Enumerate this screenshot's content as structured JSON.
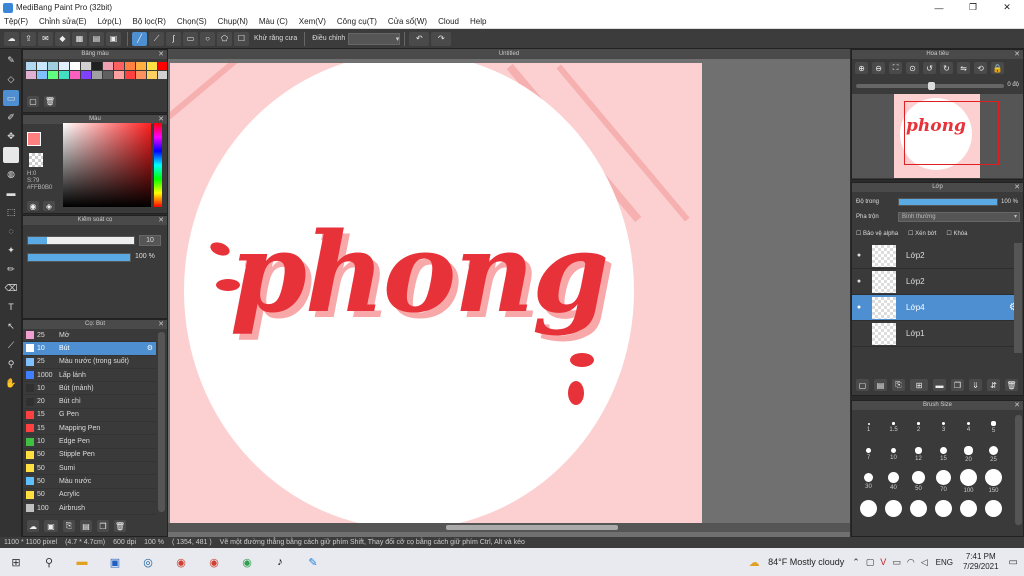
{
  "window": {
    "title": "MediBang Paint Pro (32bit)",
    "controls": [
      "—",
      "❐",
      "✕"
    ]
  },
  "menu": [
    "Tệp(F)",
    "Chỉnh sửa(E)",
    "Lớp(L)",
    "Bộ lọc(R)",
    "Chọn(S)",
    "Chụp(N)",
    "Màu (C)",
    "Xem(V)",
    "Công cụ(T)",
    "Cửa sổ(W)",
    "Cloud",
    "Help"
  ],
  "toolbar": {
    "antialias_label": "Khử răng cưa",
    "adjust_label": "Điều chỉnh",
    "undo_icon": "undo-icon",
    "redo_icon": "redo-icon"
  },
  "panels": {
    "color_palette": {
      "title": "Bảng màu",
      "swatches": [
        "#b0d8f0",
        "#c8e8ff",
        "#a0d0e0",
        "#e0f0ff",
        "#ffffff",
        "#d0d0d0",
        "#202020",
        "#f0a0b0",
        "#ff6060",
        "#ff8040",
        "#ffb040",
        "#ffe040",
        "#ff0000",
        "#e0b0d0",
        "#80c0ff",
        "#60ff80",
        "#40e0c0",
        "#ff60c0",
        "#8040ff",
        "#a0a0a0",
        "#606060",
        "#ffa0a0",
        "#ff4040",
        "#ff9060",
        "#ffd060",
        "#d0d0d0"
      ]
    },
    "color": {
      "title": "Màu",
      "main": "#ff8080",
      "sub": "#ffffff",
      "h": "H:0",
      "s": "S:79",
      "hex": "#FFB0B0"
    },
    "brush_control": {
      "title": "Kiểm soát cọ",
      "size": "10",
      "opacity": "100 %",
      "opacity_value": 1.0
    },
    "brushes": {
      "title": "Cọ: Bút",
      "items": [
        {
          "num": "25",
          "name": "Mờ",
          "color": "#f0a0d0"
        },
        {
          "num": "10",
          "name": "Bút",
          "color": "#ffffff",
          "selected": true
        },
        {
          "num": "25",
          "name": "Màu nước (trong suốt)",
          "color": "#80c0ff"
        },
        {
          "num": "1000",
          "name": "Lấp lánh",
          "color": "#4080ff"
        },
        {
          "num": "10",
          "name": "Bút (mảnh)",
          "color": "#303030"
        },
        {
          "num": "20",
          "name": "Bút chì",
          "color": "#303030"
        },
        {
          "num": "15",
          "name": "G Pen",
          "color": "#ff4040"
        },
        {
          "num": "15",
          "name": "Mapping Pen",
          "color": "#ff4040"
        },
        {
          "num": "10",
          "name": "Edge Pen",
          "color": "#40c040"
        },
        {
          "num": "50",
          "name": "Stipple Pen",
          "color": "#ffe040"
        },
        {
          "num": "50",
          "name": "Sumi",
          "color": "#ffe040"
        },
        {
          "num": "50",
          "name": "Màu nước",
          "color": "#60c0ff"
        },
        {
          "num": "50",
          "name": "Acrylic",
          "color": "#ffe040"
        },
        {
          "num": "100",
          "name": "Airbrush",
          "color": "#c0c0c0"
        }
      ]
    },
    "navigator": {
      "title": "Hoa tiêu",
      "angle": "0 độ"
    },
    "layers": {
      "title": "Lớp",
      "opacity_label": "Độ trong",
      "opacity_value": "100 %",
      "blend_label": "Pha trộn",
      "blend_value": "Bình thường",
      "options": [
        "Bảo vệ alpha",
        "Xén bớt",
        "Khóa"
      ],
      "items": [
        {
          "name": "Lớp2",
          "visible": true,
          "selected": false
        },
        {
          "name": "Lớp2",
          "visible": true,
          "selected": false
        },
        {
          "name": "Lớp4",
          "visible": true,
          "selected": true
        },
        {
          "name": "Lớp1",
          "visible": false,
          "selected": false
        }
      ]
    },
    "brush_size": {
      "title": "Brush Size",
      "sizes": [
        "1",
        "1.5",
        "2",
        "3",
        "4",
        "5",
        "7",
        "10",
        "12",
        "15",
        "20",
        "25",
        "30",
        "40",
        "50",
        "70",
        "100",
        "150"
      ]
    }
  },
  "canvas": {
    "tab": "Untitled",
    "artwork_text": "phong",
    "bg_color": "#fcd0d0",
    "circle_color": "#ffffff",
    "text_color": "#e8323a"
  },
  "status": {
    "size": "1100 * 1100 pixel",
    "dims": "(4.7 * 4.7cm)",
    "dpi": "600 dpi",
    "zoom": "100 %",
    "coords": "( 1354, 481 )",
    "hint": "Vẽ một đường thẳng bằng cách giữ phím Shift, Thay đổi cỡ cọ bằng cách giữ phím Ctrl, Alt và kéo"
  },
  "taskbar": {
    "weather": "84°F  Mostly cloudy",
    "lang": "ENG",
    "time": "7:41 PM",
    "date": "7/29/2021"
  }
}
